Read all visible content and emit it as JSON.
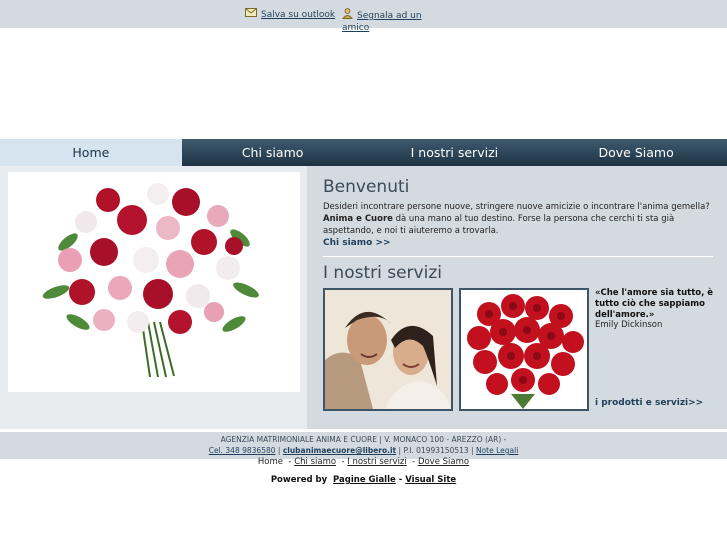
{
  "topbar": {
    "save_outlook": "Salva su outlook",
    "segnala": "Segnala ad un amico"
  },
  "nav": {
    "items": [
      "Home",
      "Chi siamo",
      "I nostri servizi",
      "Dove Siamo"
    ]
  },
  "welcome": {
    "title": "Benvenuti",
    "text_1": "Desideri incontrare persone nuove, stringere nuove amicizie o incontrare l'anima gemella? ",
    "text_bold": "Anima e Cuore",
    "text_2": " dà una mano al tuo destino. Forse la persona che cerchi ti sta già aspettando, e noi ti aiuteremo a trovarla.",
    "more_link": "Chi siamo >>"
  },
  "services": {
    "title": "I nostri servizi",
    "quote": "«Che l'amore sia tutto, è tutto ciò che sappiamo dell'amore.»",
    "author": "Emily Dickinson",
    "more_link": "i prodotti e servizi>>"
  },
  "footer": {
    "line1": "AGENZIA MATRIMONIALE ANIMA E CUORE | V. MONACO 100 - AREZZO (AR) -",
    "phone": "Cel. 348 9836580",
    "email": "clubanimaecuore@libero.it",
    "piva": "P.I. 01993150513",
    "note": "Note Legali"
  },
  "bottom_links": [
    "Home",
    "Chi siamo",
    "I nostri servizi",
    "Dove Siamo"
  ],
  "powered": {
    "label": "Powered by",
    "pagine": "Pagine Gialle",
    "visual": "Visual Site"
  },
  "colors": {
    "nav_dark": "#1d3344",
    "panel": "#d4dbe0",
    "accent_link": "#1f3f5c"
  }
}
